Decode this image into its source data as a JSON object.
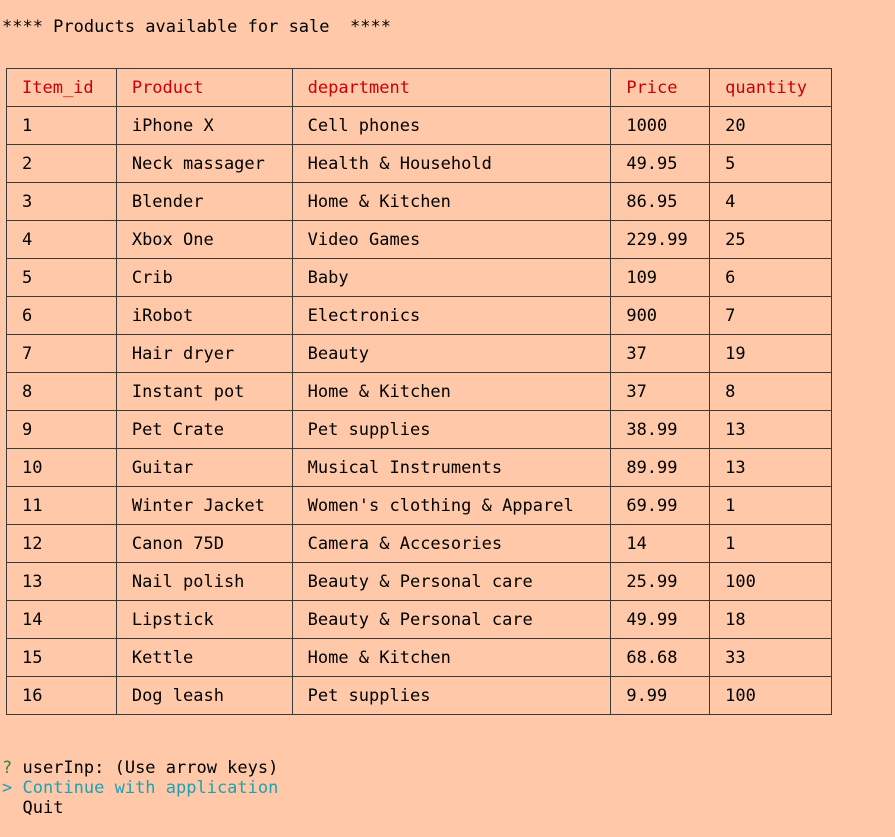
{
  "title": "**** Products available for sale  ****",
  "table": {
    "headers": [
      "Item_id",
      "Product",
      "department",
      "Price",
      "quantity"
    ],
    "rows": [
      [
        "1",
        "iPhone X",
        "Cell phones",
        "1000",
        "20"
      ],
      [
        "2",
        "Neck massager",
        "Health & Household",
        "49.95",
        "5"
      ],
      [
        "3",
        "Blender",
        "Home & Kitchen",
        "86.95",
        "4"
      ],
      [
        "4",
        "Xbox One",
        "Video Games",
        "229.99",
        "25"
      ],
      [
        "5",
        "Crib",
        "Baby",
        "109",
        "6"
      ],
      [
        "6",
        "iRobot",
        "Electronics",
        "900",
        "7"
      ],
      [
        "7",
        "Hair dryer",
        "Beauty",
        "37",
        "19"
      ],
      [
        "8",
        "Instant pot",
        "Home & Kitchen",
        "37",
        "8"
      ],
      [
        "9",
        "Pet Crate",
        "Pet supplies",
        "38.99",
        "13"
      ],
      [
        "10",
        "Guitar",
        "Musical Instruments",
        "89.99",
        "13"
      ],
      [
        "11",
        "Winter Jacket",
        "Women's clothing & Apparel",
        "69.99",
        "1"
      ],
      [
        "12",
        "Canon 75D",
        "Camera & Accesories",
        "14",
        "1"
      ],
      [
        "13",
        "Nail polish",
        "Beauty & Personal care",
        "25.99",
        "100"
      ],
      [
        "14",
        "Lipstick",
        "Beauty & Personal care",
        "49.99",
        "18"
      ],
      [
        "15",
        "Kettle",
        "Home & Kitchen",
        "68.68",
        "33"
      ],
      [
        "16",
        "Dog leash",
        "Pet supplies",
        "9.99",
        "100"
      ]
    ]
  },
  "prompt": {
    "marker": "?",
    "text": " userInp: (Use arrow keys)"
  },
  "choices": {
    "pointer": "> ",
    "active": "Continue with application",
    "inactive_indent": "  ",
    "inactive": "Quit"
  },
  "colors": {
    "background": "#ffc8a8",
    "header_text": "#cc0000",
    "prompt_marker": "#2e8b2e",
    "active_choice": "#1aa3b5"
  }
}
